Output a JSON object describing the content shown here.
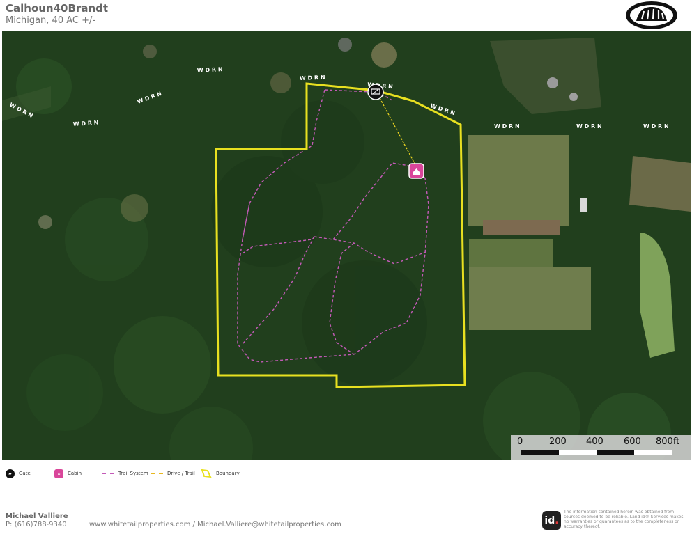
{
  "header": {
    "title": "Calhoun40Brandt",
    "subtitle": "Michigan, 40 AC +/-"
  },
  "map": {
    "road_label": "W D R N",
    "road_labels": [
      {
        "id": "r1",
        "text": "W D R N"
      },
      {
        "id": "r2",
        "text": "W D R N"
      },
      {
        "id": "r3",
        "text": "W D R N"
      },
      {
        "id": "r4",
        "text": "W D R N"
      },
      {
        "id": "r5",
        "text": "W D R N"
      },
      {
        "id": "r6",
        "text": "W D R N"
      },
      {
        "id": "r7",
        "text": "W D R N"
      },
      {
        "id": "r8",
        "text": "W D R N"
      },
      {
        "id": "r9",
        "text": "W D R N"
      },
      {
        "id": "r10",
        "text": "W D R N"
      }
    ],
    "colors": {
      "boundary": "#e8e020",
      "trail_system": "#c45ab8",
      "drive_trail": "#e8d020",
      "cabin": "#d9469a",
      "gate": "#111111"
    },
    "scale_bar": {
      "labels": [
        "0",
        "200",
        "400",
        "600",
        "800ft"
      ]
    }
  },
  "legend": {
    "gate": {
      "label": "Gate",
      "icon": "gate-icon"
    },
    "cabin": {
      "label": "Cabin",
      "icon": "cabin-icon"
    },
    "trail_system": {
      "label": "Trail System"
    },
    "drive_trail": {
      "label": "Drive / Trail"
    },
    "boundary": {
      "label": "Boundary"
    }
  },
  "footer": {
    "name": "Michael Valliere",
    "phone": "P: (616)788-9340",
    "web": "www.whitetailproperties.com / Michael.Valliere@whitetailproperties.com",
    "badge_text": "id",
    "disclaimer": "The information contained herein was obtained from sources deemed to be reliable. Land id® Services makes no warranties or guarantees as to the completeness or accuracy thereof."
  }
}
